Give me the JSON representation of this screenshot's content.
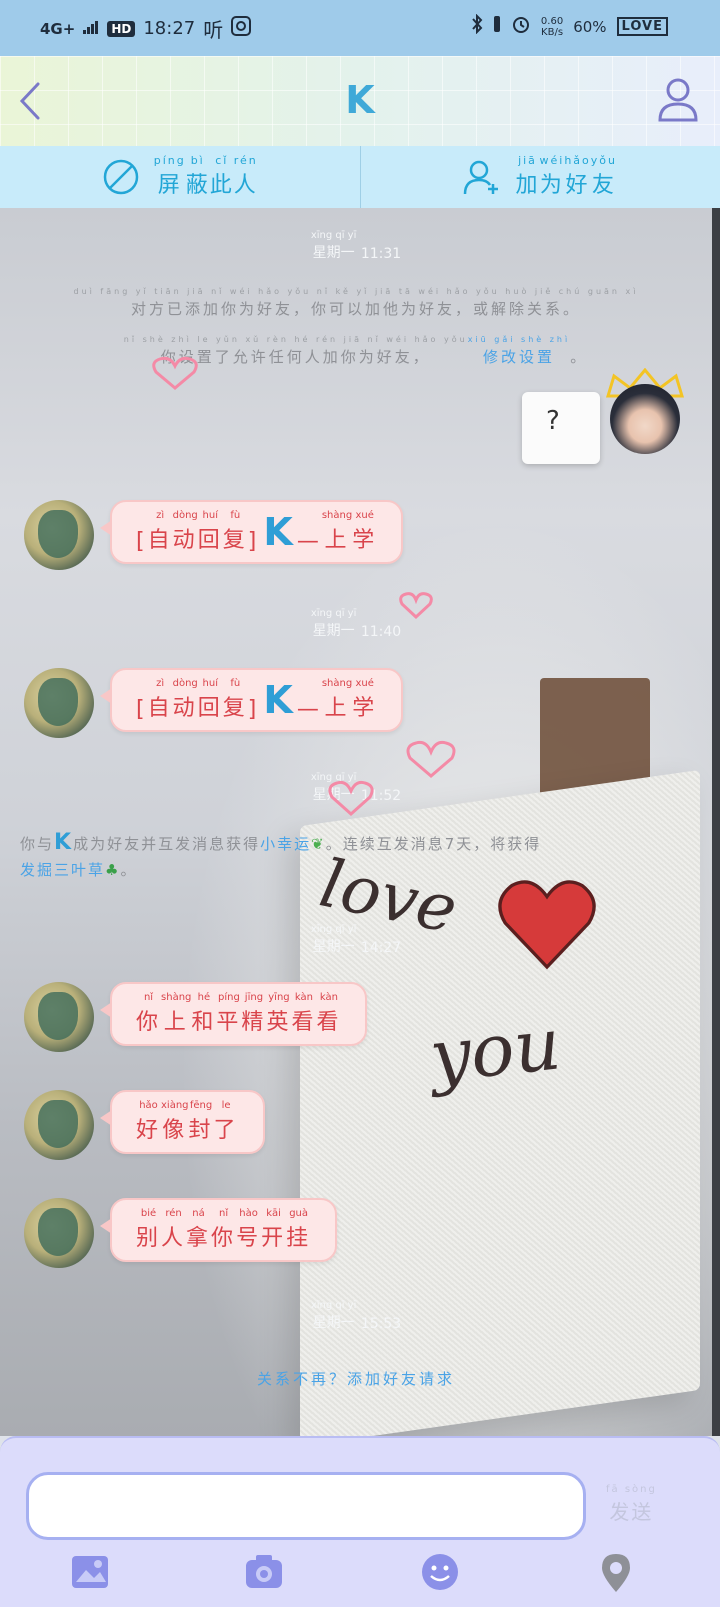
{
  "status_bar": {
    "network": "4G+",
    "hd": "HD",
    "time": "18:27",
    "audio_glyph": "听",
    "speed_value": "0.60",
    "speed_unit": "KB/s",
    "battery": "60%",
    "love_badge": "LOVE"
  },
  "header": {
    "title": "K"
  },
  "actions": {
    "block": {
      "label_chars": [
        "屏",
        "蔽",
        "此",
        "人"
      ],
      "label_pinyin": [
        "píng",
        "bì",
        "cǐ",
        "rén"
      ]
    },
    "add_friend": {
      "label_chars": [
        "加",
        "为",
        "好",
        "友"
      ],
      "label_pinyin": [
        "jiā",
        "wéi",
        "hǎo",
        "yǒu"
      ]
    }
  },
  "timestamps": {
    "t1": {
      "hz": "星期一",
      "py": "xīng qī yī",
      "time": "11:31"
    },
    "t2": {
      "hz": "星期一",
      "py": "xīng qī yī",
      "time": "11:40"
    },
    "t3": {
      "hz": "星期一",
      "py": "xīng qī yī",
      "time": "11:52"
    },
    "t4": {
      "hz": "星期一",
      "py": "xīng qī yī",
      "time": "14:27"
    },
    "t5": {
      "hz": "星期一",
      "py": "xīng qī yī",
      "time": "15:53"
    }
  },
  "system": {
    "added": "对方已添加你为好友，你可以加他为好友，或解除关系。",
    "added_py": "duì fāng yǐ tiān jiā nǐ wéi hǎo yǒu   nǐ kě yǐ jiā tā wéi hǎo yǒu   huò jiě chú guān xì",
    "privacy_prefix": "你设置了允许任何人加你为好友，",
    "privacy_link": "修改设置",
    "privacy_end": "。",
    "privacy_py": "nǐ shè zhì le yǔn xǔ rèn hé rén jiā nǐ wéi hǎo yǒu",
    "privacy_link_py": "xiū gǎi shè zhì",
    "clover_1a": "你与",
    "clover_1k": "K",
    "clover_1b": "成为好友并互发消息获得",
    "clover_link": "小幸运",
    "clover_1c": "。连续互发消息7天，将获得",
    "clover_2": "发掘三叶草",
    "clover_2end": "。",
    "bottom_text": "关系不再？添加好友请求"
  },
  "messages": {
    "m1": {
      "bracket_l": "[",
      "chars": [
        "自",
        "动",
        "回",
        "复"
      ],
      "py": [
        "zì",
        "dòng",
        "huí",
        "fù"
      ],
      "bracket_r": "]",
      "k": "K",
      "dash": "—",
      "tail": [
        "上",
        "学"
      ],
      "tail_py": [
        "shàng",
        "xué"
      ]
    },
    "m2": {
      "bracket_l": "[",
      "chars": [
        "自",
        "动",
        "回",
        "复"
      ],
      "py": [
        "zì",
        "dòng",
        "huí",
        "fù"
      ],
      "bracket_r": "]",
      "k": "K",
      "dash": "—",
      "tail": [
        "上",
        "学"
      ],
      "tail_py": [
        "shàng",
        "xué"
      ]
    },
    "m3": {
      "chars": [
        "你",
        "上",
        "和",
        "平",
        "精",
        "英",
        "看",
        "看"
      ],
      "py": [
        "nǐ",
        "shàng",
        "hé",
        "píng",
        "jīng",
        "yīng",
        "kàn",
        "kàn"
      ]
    },
    "m4": {
      "chars": [
        "好",
        "像",
        "封",
        "了"
      ],
      "py": [
        "hǎo",
        "xiàng",
        "fēng",
        "le"
      ]
    },
    "m5": {
      "chars": [
        "别",
        "人",
        "拿",
        "你",
        "号",
        "开",
        "挂"
      ],
      "py": [
        "bié",
        "rén",
        "ná",
        "nǐ",
        "hào",
        "kāi",
        "guà"
      ]
    },
    "sent_sticker": "?"
  },
  "art": {
    "love": "love",
    "you": "you"
  },
  "input": {
    "value": "",
    "send_label": "发送",
    "send_py": "fā sòng"
  },
  "toolbar": {
    "icons": [
      "image-icon",
      "camera-icon",
      "emoji-icon",
      "location-icon"
    ]
  },
  "colors": {
    "accent": "#3fa9d8",
    "bubble_bg": "#fde7e7",
    "bubble_text": "#d9444b",
    "link": "#4aa3e6"
  }
}
